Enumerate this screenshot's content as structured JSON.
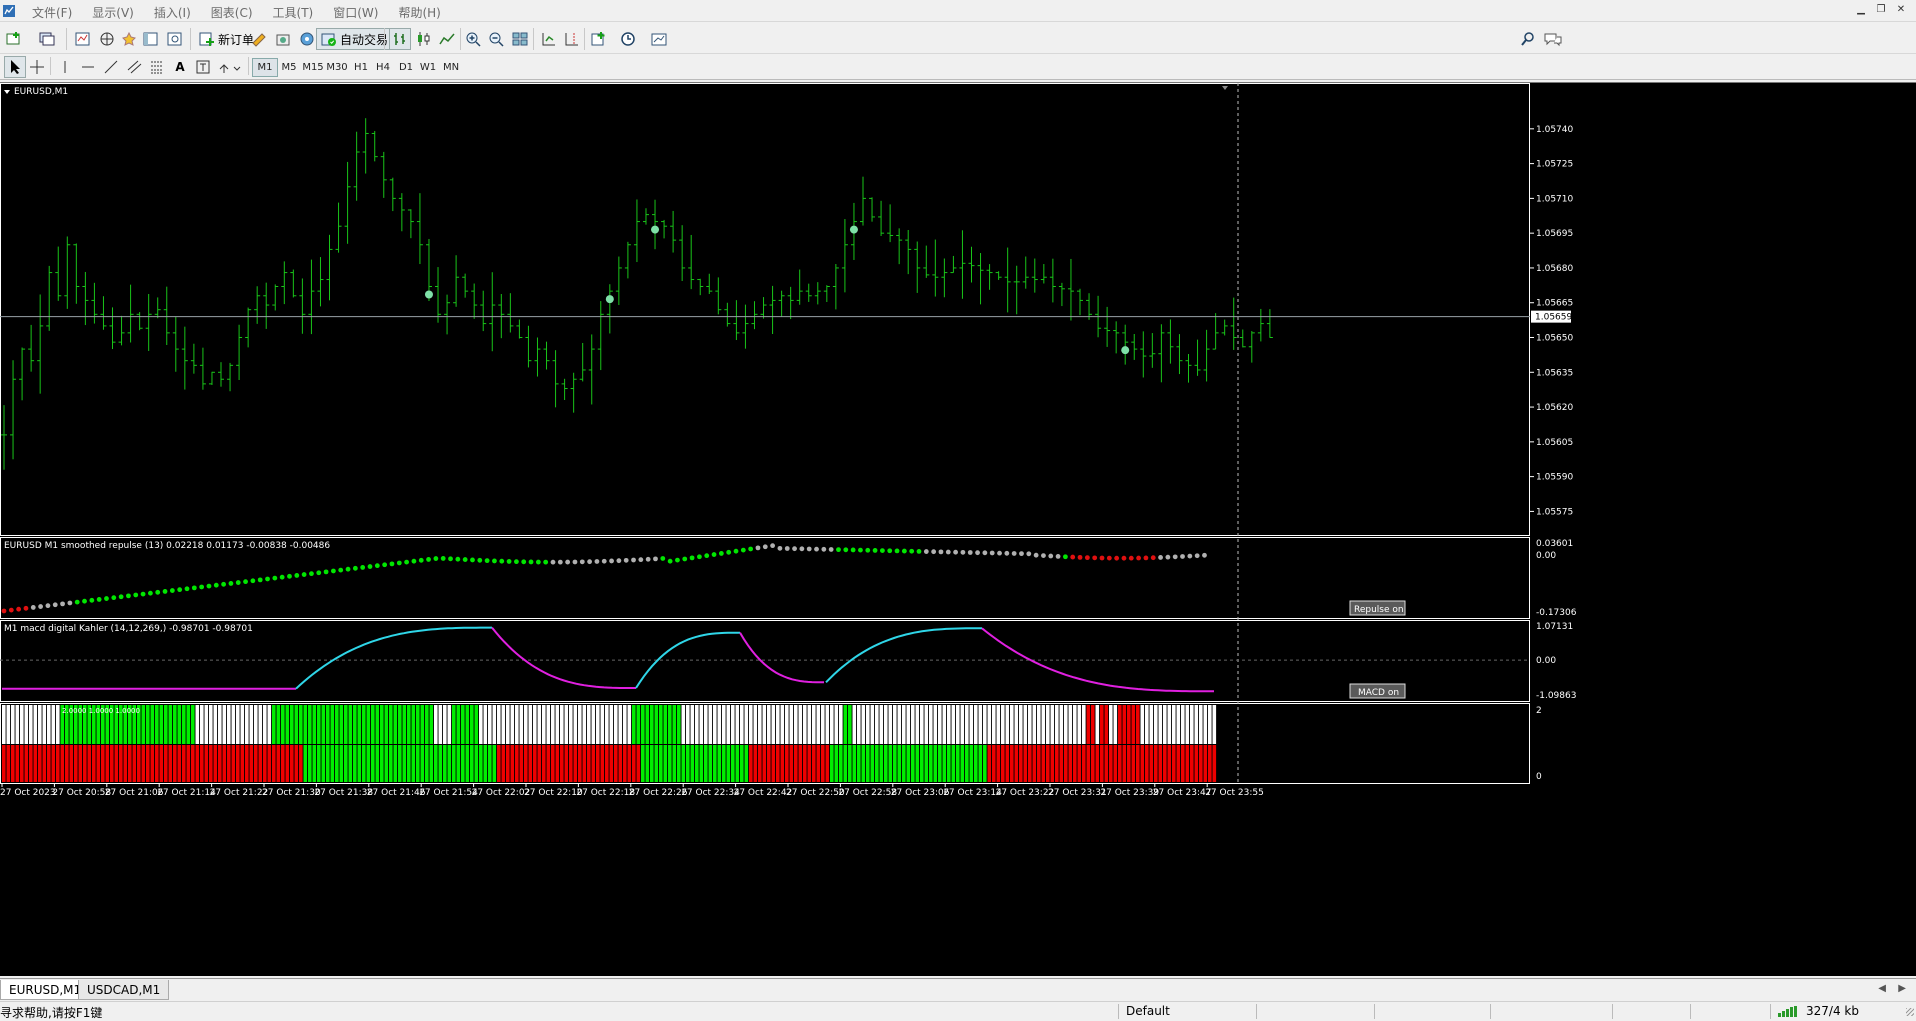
{
  "menu": {
    "items": [
      "文件(F)",
      "显示(V)",
      "插入(I)",
      "图表(C)",
      "工具(T)",
      "窗口(W)",
      "帮助(H)"
    ]
  },
  "toolbar": {
    "new_order_label": "新订单",
    "auto_trading_label": "自动交易",
    "icons": [
      "new-chart-icon",
      "profiles-icon",
      "market-watch-icon",
      "navigator-icon",
      "data-window-icon",
      "terminal-icon",
      "strategy-tester-icon",
      "metaeditor-icon",
      "autotrading-icon",
      "bar-chart-icon",
      "candle-chart-icon",
      "line-chart-icon",
      "zoom-in-icon",
      "zoom-out-icon",
      "tile-icon",
      "autoscroll-icon",
      "chart-shift-icon",
      "indicators-icon",
      "periods-icon",
      "templates-icon",
      "search-icon",
      "chat-icon"
    ]
  },
  "timeframes": [
    "M1",
    "M5",
    "M15",
    "M30",
    "H1",
    "H4",
    "D1",
    "W1",
    "MN"
  ],
  "active_timeframe": "M1",
  "chart": {
    "title": "EURUSD,M1",
    "current_price_label": "1.05659",
    "price_ticks": [
      "1.05740",
      "1.05725",
      "1.05710",
      "1.05695",
      "1.05680",
      "1.05665",
      "1.05650",
      "1.05635",
      "1.05620",
      "1.05605",
      "1.05590",
      "1.05575"
    ],
    "time_ticks": [
      "27 Oct 2023",
      "27 Oct 20:58",
      "27 Oct 21:06",
      "27 Oct 21:14",
      "27 Oct 21:22",
      "27 Oct 21:30",
      "27 Oct 21:38",
      "27 Oct 21:46",
      "27 Oct 21:54",
      "27 Oct 22:02",
      "27 Oct 22:10",
      "27 Oct 22:18",
      "27 Oct 22:26",
      "27 Oct 22:34",
      "27 Oct 22:42",
      "27 Oct 22:50",
      "27 Oct 22:58",
      "27 Oct 23:06",
      "27 Oct 23:14",
      "27 Oct 23:22",
      "27 Oct 23:31",
      "27 Oct 23:39",
      "27 Oct 23:47",
      "27 Oct 23:55"
    ]
  },
  "chart_data": [
    {
      "type": "ohlc",
      "title": "EURUSD,M1",
      "ylim": [
        1.0557,
        1.05752
      ],
      "last_price": 1.05659,
      "closes": [
        1.05608,
        1.05632,
        1.05645,
        1.0564,
        1.05655,
        1.05678,
        1.05668,
        1.0569,
        1.05672,
        1.05666,
        1.0566,
        1.05655,
        1.05648,
        1.05652,
        1.0566,
        1.05654,
        1.0566,
        1.05662,
        1.05652,
        1.05645,
        1.0564,
        1.05638,
        1.0563,
        1.05635,
        1.05632,
        1.05638,
        1.0565,
        1.05662,
        1.05668,
        1.05664,
        1.05672,
        1.05678,
        1.05668,
        1.0566,
        1.0567,
        1.05675,
        1.05688,
        1.05698,
        1.05715,
        1.0573,
        1.05738,
        1.05728,
        1.05718,
        1.0571,
        1.05705,
        1.057,
        1.0569,
        1.05672,
        1.0566,
        1.05665,
        1.05676,
        1.0567,
        1.05664,
        1.05656,
        1.05664,
        1.0566,
        1.05655,
        1.0565,
        1.0564,
        1.05645,
        1.0564,
        1.0563,
        1.05628,
        1.05632,
        1.05636,
        1.05645,
        1.0566,
        1.0567,
        1.0568,
        1.0569,
        1.057,
        1.05703,
        1.057,
        1.05698,
        1.05692,
        1.0568,
        1.05675,
        1.05672,
        1.0567,
        1.05662,
        1.05656,
        1.05652,
        1.05656,
        1.0566,
        1.05664,
        1.05666,
        1.05668,
        1.05666,
        1.0567,
        1.05668,
        1.0567,
        1.05672,
        1.0568,
        1.0569,
        1.057,
        1.0571,
        1.05702,
        1.05695,
        1.05694,
        1.05692,
        1.05688,
        1.0568,
        1.05677,
        1.05676,
        1.05678,
        1.0568,
        1.05682,
        1.05681,
        1.05679,
        1.05678,
        1.05676,
        1.05674,
        1.05674,
        1.05676,
        1.05675,
        1.05676,
        1.05672,
        1.05671,
        1.0567,
        1.05666,
        1.0566,
        1.05654,
        1.05653,
        1.05652,
        1.05648,
        1.05645,
        1.05642,
        1.05643,
        1.05652,
        1.05646,
        1.0564,
        1.05638,
        1.05636,
        1.05645,
        1.05652,
        1.05655,
        1.0565,
        1.05646,
        1.05652,
        1.05656,
        1.0565
      ]
    },
    {
      "type": "scatter",
      "title": "EURUSD M1 smoothed repulse (13)",
      "header_values": "0.02218 0.01173 -0.00838 -0.00486",
      "ylim": [
        -0.17306,
        0.03601
      ],
      "scale_labels": [
        "0.03601",
        "0.00",
        "-0.17306"
      ],
      "colors": {
        "up": "#00e600",
        "neutral": "#b0b0b0",
        "down": "#e01010"
      },
      "button_label": "Repulse on"
    },
    {
      "type": "line",
      "title": "macd digital Kahler (14,12,269,)",
      "prefix": "M1",
      "header_values": "-0.98701 -0.98701",
      "ylim": [
        -1.09863,
        1.07131
      ],
      "scale_labels": [
        "1.07131",
        "0.00",
        "-1.09863"
      ],
      "colors": {
        "rising": "#2fd6e8",
        "falling": "#e020e0"
      },
      "button_label": "MACD on"
    },
    {
      "type": "heatmap",
      "scale_labels": [
        "2",
        "0"
      ],
      "row_labels": "2.0000 1.0000 1.0000",
      "colors": {
        "green": "#00ee00",
        "red": "#ee0000",
        "white": "#ffffff"
      }
    }
  ],
  "tabs": [
    "EURUSD,M1",
    "USDCAD,M1"
  ],
  "status": {
    "help": "寻求帮助,请按F1键",
    "profile": "Default",
    "traffic": "327/4 kb"
  }
}
